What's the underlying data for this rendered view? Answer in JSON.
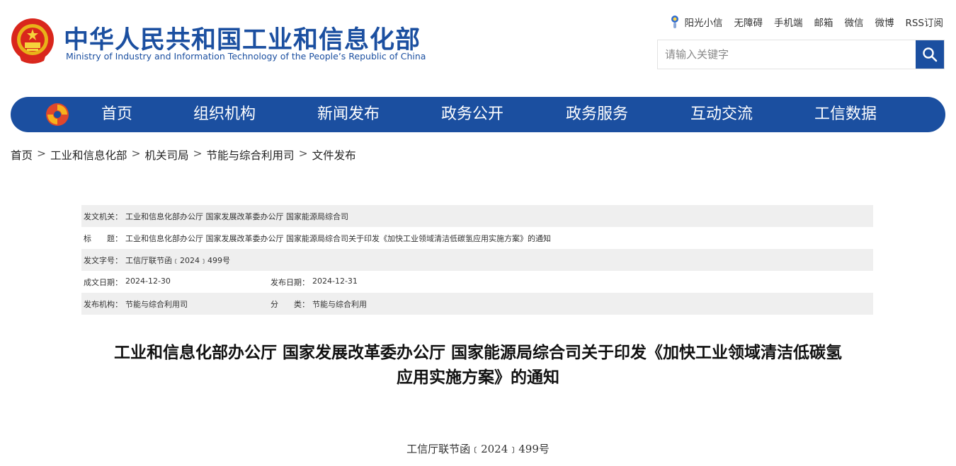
{
  "header": {
    "title_cn": "中华人民共和国工业和信息化部",
    "title_en": "Ministry of Industry and Information Technology of the People’s Republic of China",
    "top_links": [
      "阳光小信",
      "无障碍",
      "手机端",
      "邮箱",
      "微信",
      "微博",
      "RSS订阅"
    ],
    "search_placeholder": "请输入关键字"
  },
  "nav": {
    "items": [
      "首页",
      "组织机构",
      "新闻发布",
      "政务公开",
      "政务服务",
      "互动交流",
      "工信数据"
    ]
  },
  "breadcrumb": [
    "首页",
    "工业和信息化部",
    "机关司局",
    "节能与综合利用司",
    "文件发布"
  ],
  "breadcrumb_separator": ">",
  "meta": {
    "issuer_label": "发文机关：",
    "issuer": "工业和信息化部办公厅 国家发展改革委办公厅 国家能源局综合司",
    "title_label": "标　　题：",
    "title": "工业和信息化部办公厅 国家发展改革委办公厅 国家能源局综合司关于印发《加快工业领域清洁低碳氢应用实施方案》的通知",
    "doc_no_label": "发文字号：",
    "doc_no": "工信厅联节函﹝2024﹞499号",
    "created_label": "成文日期：",
    "created": "2024-12-30",
    "published_label": "发布日期：",
    "published": "2024-12-31",
    "org_label": "发布机构：",
    "org": "节能与综合利用司",
    "category_label": "分　　类：",
    "category": "节能与综合利用"
  },
  "document": {
    "title_line1": "工业和信息化部办公厅 国家发展改革委办公厅 国家能源局综合司关于印发《加快工业领域清洁低碳氢",
    "title_line2": "应用实施方案》的通知",
    "number": "工信厅联节函﹝2024﹞499号"
  },
  "colors": {
    "brand_blue": "#1b4fa0",
    "meta_shade": "#efefef"
  }
}
